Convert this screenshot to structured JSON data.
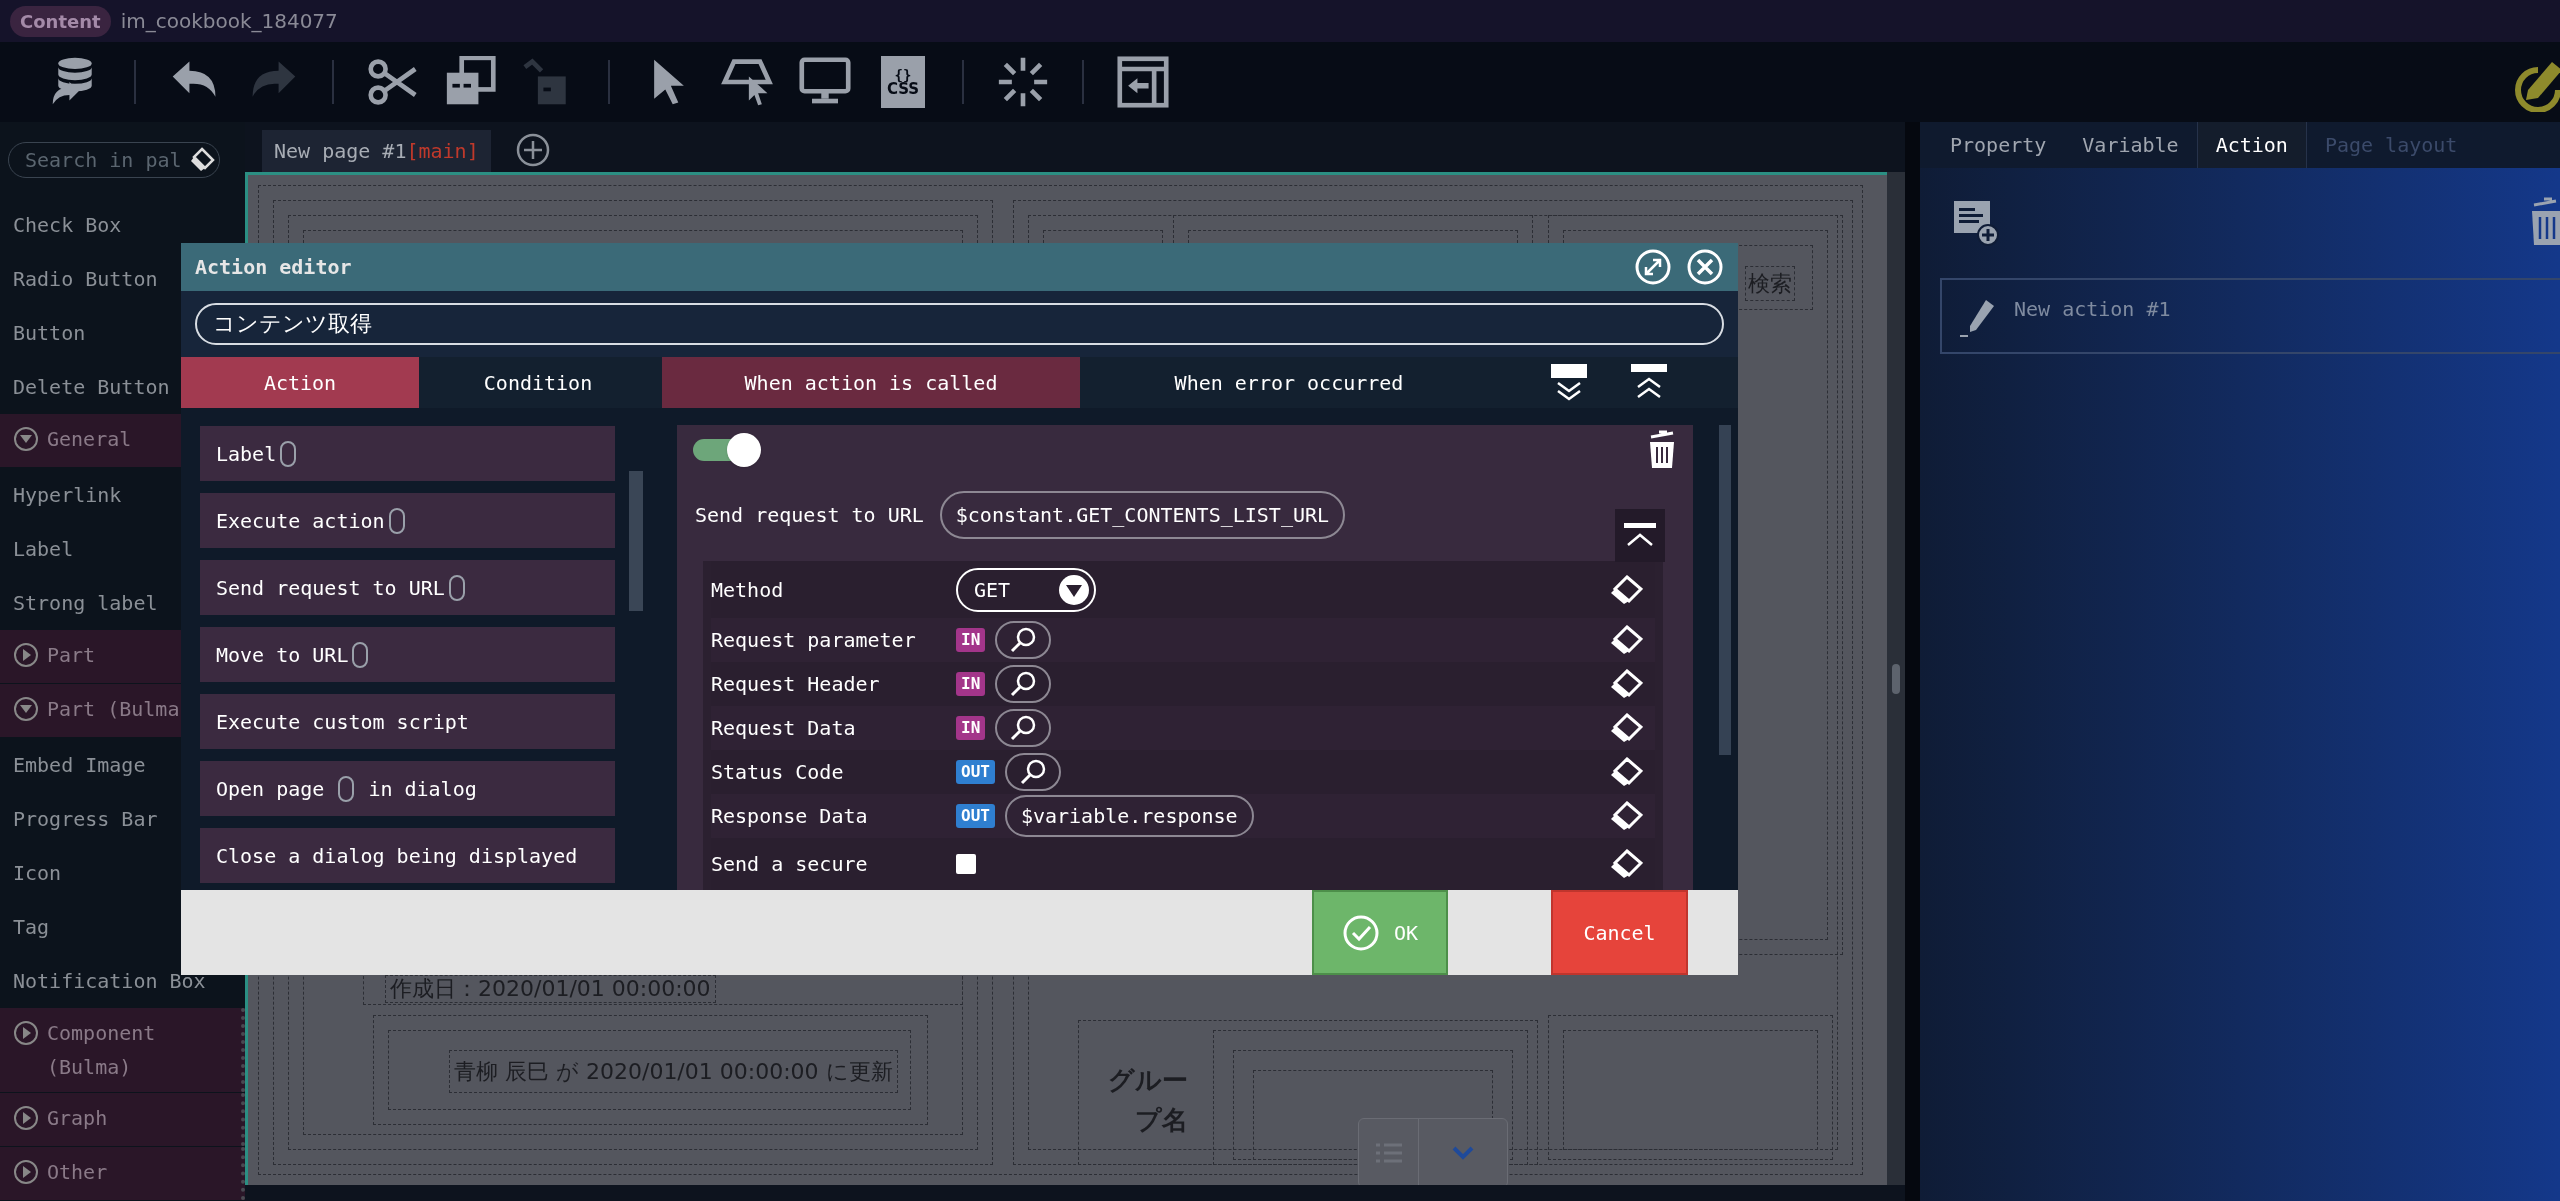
{
  "app_bar": {
    "badge": "Content",
    "project": "im_cookbook_184077"
  },
  "toolbar": [
    {
      "kind": "tool",
      "disabled": false
    },
    {
      "kind": "separator"
    },
    {
      "kind": "tool",
      "disabled": false
    },
    {
      "kind": "tool",
      "disabled": true
    },
    {
      "kind": "separator"
    },
    {
      "kind": "tool",
      "disabled": false
    },
    {
      "kind": "tool",
      "disabled": false
    },
    {
      "kind": "tool",
      "disabled": true
    },
    {
      "kind": "separator"
    },
    {
      "kind": "tool",
      "disabled": false
    },
    {
      "kind": "tool",
      "disabled": false
    },
    {
      "kind": "tool",
      "disabled": false
    },
    {
      "kind": "labeled_tool",
      "disabled": false,
      "braces": "{}",
      "text": "CSS"
    },
    {
      "kind": "separator"
    },
    {
      "kind": "tool",
      "disabled": false
    },
    {
      "kind": "separator"
    },
    {
      "kind": "tool",
      "disabled": false
    }
  ],
  "palette": {
    "search": {
      "placeholder": "Search in pal"
    },
    "items": [
      {
        "kind": "item",
        "label": "Check Box"
      },
      {
        "kind": "item",
        "label": "Radio Button"
      },
      {
        "kind": "item",
        "label": "Button"
      },
      {
        "kind": "item",
        "label": "Delete Button"
      },
      {
        "kind": "category",
        "label": "General",
        "expanded": true,
        "children": [
          {
            "kind": "item",
            "label": "Hyperlink"
          },
          {
            "kind": "item",
            "label": "Label"
          },
          {
            "kind": "item",
            "label": "Strong label"
          }
        ]
      },
      {
        "kind": "category",
        "label": "Part",
        "expanded": false
      },
      {
        "kind": "category",
        "label": "Part (Bulma",
        "expanded": true,
        "children": [
          {
            "kind": "item",
            "label": "Embed Image"
          },
          {
            "kind": "item",
            "label": "Progress Bar"
          },
          {
            "kind": "item",
            "label": "Icon"
          },
          {
            "kind": "item",
            "label": "Tag"
          },
          {
            "kind": "item",
            "label": "Notification Box"
          }
        ]
      },
      {
        "kind": "category",
        "label": "Component (Bulma)",
        "expanded": false
      },
      {
        "kind": "category",
        "label": "Graph",
        "expanded": false
      },
      {
        "kind": "category",
        "label": "Other",
        "expanded": false
      }
    ]
  },
  "page_tabs": [
    {
      "label": "New page #1",
      "tag": "[main]",
      "selected": true
    }
  ],
  "canvas": {
    "search_label": "検索",
    "created": "作成日：2020/01/01 00:00:00",
    "updated": "青柳 辰巳 が 2020/01/01 00:00:00 に更新",
    "group_label": "グループ名"
  },
  "action_editor": {
    "title": "Action editor",
    "name": "コンテンツ取得",
    "mode_tabs": [
      {
        "label": "Action",
        "selected": true
      },
      {
        "label": "Condition",
        "selected": false
      }
    ],
    "trigger_tabs": [
      {
        "label": "When action is called",
        "selected": true
      },
      {
        "label": "When error occurred",
        "selected": false
      }
    ],
    "palette_items": [
      {
        "label": "Label",
        "slot": true
      },
      {
        "label": "Execute action",
        "slot": true
      },
      {
        "label": "Send request to URL",
        "slot": true
      },
      {
        "label": "Move to URL",
        "slot": true
      },
      {
        "label": "Execute custom script",
        "slot": false
      },
      {
        "label": "Open page",
        "slot": true,
        "suffix": "in dialog"
      },
      {
        "label": "Close a dialog being displayed",
        "slot": false
      }
    ],
    "step": {
      "enabled": true,
      "type": "Send request to URL",
      "url": "$constant.GET_CONTENTS_LIST_URL",
      "params": [
        {
          "kind": "select",
          "label": "Method",
          "value": "GET"
        },
        {
          "kind": "picker",
          "label": "Request parameter",
          "direction": "IN"
        },
        {
          "kind": "picker",
          "label": "Request Header",
          "direction": "IN"
        },
        {
          "kind": "picker",
          "label": "Request Data",
          "direction": "IN"
        },
        {
          "kind": "picker",
          "label": "Status Code",
          "direction": "OUT"
        },
        {
          "kind": "picker",
          "label": "Response Data",
          "direction": "OUT",
          "value": "$variable.response"
        },
        {
          "kind": "checkbox",
          "label": "Send a secure",
          "checked": false
        }
      ]
    },
    "buttons": [
      {
        "kind": "ok",
        "label": "OK"
      },
      {
        "kind": "cancel",
        "label": "Cancel"
      }
    ]
  },
  "side_panel": {
    "tabs": [
      {
        "label": "Property",
        "selected": false,
        "disabled": false
      },
      {
        "label": "Variable",
        "selected": false,
        "disabled": false
      },
      {
        "label": "Action",
        "selected": true,
        "disabled": false
      },
      {
        "label": "Page layout",
        "selected": false,
        "disabled": true
      }
    ],
    "actions": [
      {
        "label": "New action #1"
      }
    ]
  }
}
